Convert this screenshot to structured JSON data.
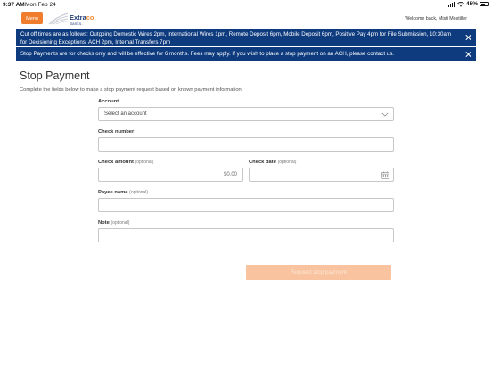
{
  "statusbar": {
    "time": "9:37 AM",
    "date": "Mon Feb 24",
    "battery": "45%"
  },
  "header": {
    "menu_label": "Menu",
    "logo_name": "Extra",
    "logo_name_accent": "co",
    "logo_sub": "Banks.",
    "welcome": "Welcome back, Misti Mostiller"
  },
  "alerts": [
    {
      "text": "Cut off times are as follows: Outgoing Domestic Wires 2pm, International Wires 1pm, Remote Deposit 6pm, Mobile Deposit 6pm, Positive Pay 4pm for File Submission, 10:30am for Decisioning Exceptions, ACH 2pm, Internal Transfers 7pm"
    },
    {
      "text": "Stop Payments are for checks only and will be effective for 6 months. Fees may apply. If you wish to place a stop payment on an ACH, please contact us."
    }
  ],
  "page": {
    "title": "Stop Payment",
    "description": "Complete the fields below to make a stop payment request based on known payment information."
  },
  "form": {
    "account_label": "Account",
    "account_value": "Select an account",
    "check_number_label": "Check number",
    "check_amount_label": "Check amount",
    "check_amount_value": "$0.00",
    "check_date_label": "Check date",
    "payee_label": "Payee name",
    "note_label": "Note",
    "optional": "(optional)",
    "submit_label": "Request stop payment"
  },
  "colors": {
    "accent": "#ef7d2d",
    "alert_bg": "#0e3b7e",
    "submit_disabled": "#f9c39f"
  }
}
